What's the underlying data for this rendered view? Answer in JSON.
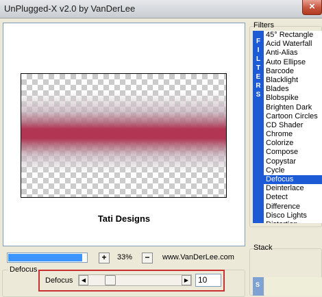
{
  "window": {
    "title": "UnPlugged-X v2.0 by VanDerLee",
    "close_glyph": "×"
  },
  "preview": {
    "credit": "Tati Designs",
    "band_color": "#b23654"
  },
  "zoom": {
    "progress": 0.95,
    "plus_label": "+",
    "value": "33%",
    "minus_label": "−",
    "url": "www.VanDerLee.com"
  },
  "parameters": {
    "group_title": "Defocus",
    "label": "Defocus",
    "slider_fraction": 0.2,
    "value": "10"
  },
  "filters": {
    "title": "Filters",
    "strip_letters": [
      "F",
      "I",
      "L",
      "T",
      "E",
      "R",
      "S"
    ],
    "selected": "Defocus",
    "items": [
      "45° Rectangle",
      "Acid Waterfall",
      "Anti-Alias",
      "Auto Ellipse",
      "Barcode",
      "Blacklight",
      "Blades",
      "Blobspike",
      "Brighten Dark",
      "Cartoon Circles",
      "CD Shader",
      "Chrome",
      "Colorize",
      "Compose",
      "Copystar",
      "Cycle",
      "Defocus",
      "Deinterlace",
      "Detect",
      "Difference",
      "Disco Lights",
      "Distortion"
    ]
  },
  "stack": {
    "title": "Stack",
    "strip_letter": "S"
  },
  "colors": {
    "accent": "#1d5bd6",
    "highlight_box": "#c83030",
    "progress": "#3d95ff"
  }
}
